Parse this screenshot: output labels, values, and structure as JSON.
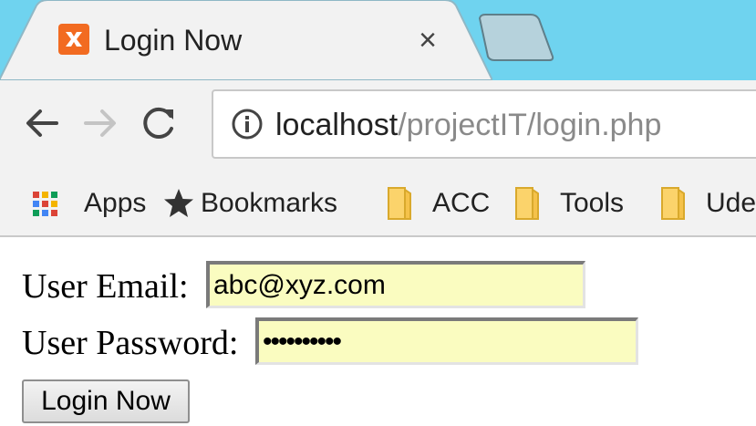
{
  "tab": {
    "title": "Login Now",
    "close_glyph": "×",
    "favicon": "xampp-icon",
    "colors": {
      "strip": "#6fd3ef",
      "active": "#f2f2f2",
      "favicon": "#f26b21"
    }
  },
  "toolbar": {
    "back_icon": "arrow-left-icon",
    "forward_icon": "arrow-right-icon",
    "reload_icon": "reload-icon",
    "info_icon": "info-icon",
    "url_host": "localhost",
    "url_path": "/projectIT/login.php"
  },
  "bookmarks": {
    "items": [
      {
        "label": "Apps",
        "icon": "apps-grid-icon"
      },
      {
        "label": "Bookmarks",
        "icon": "star-icon"
      },
      {
        "label": "ACC",
        "icon": "folder-icon"
      },
      {
        "label": "Tools",
        "icon": "folder-icon"
      },
      {
        "label": "Ude",
        "icon": "folder-icon"
      }
    ]
  },
  "form": {
    "email_label": "User Email:",
    "email_value": "abc@xyz.com",
    "password_label": "User Password:",
    "password_value": "••••••••••",
    "submit_label": "Login Now",
    "autofill_color": "#fafcc0"
  }
}
